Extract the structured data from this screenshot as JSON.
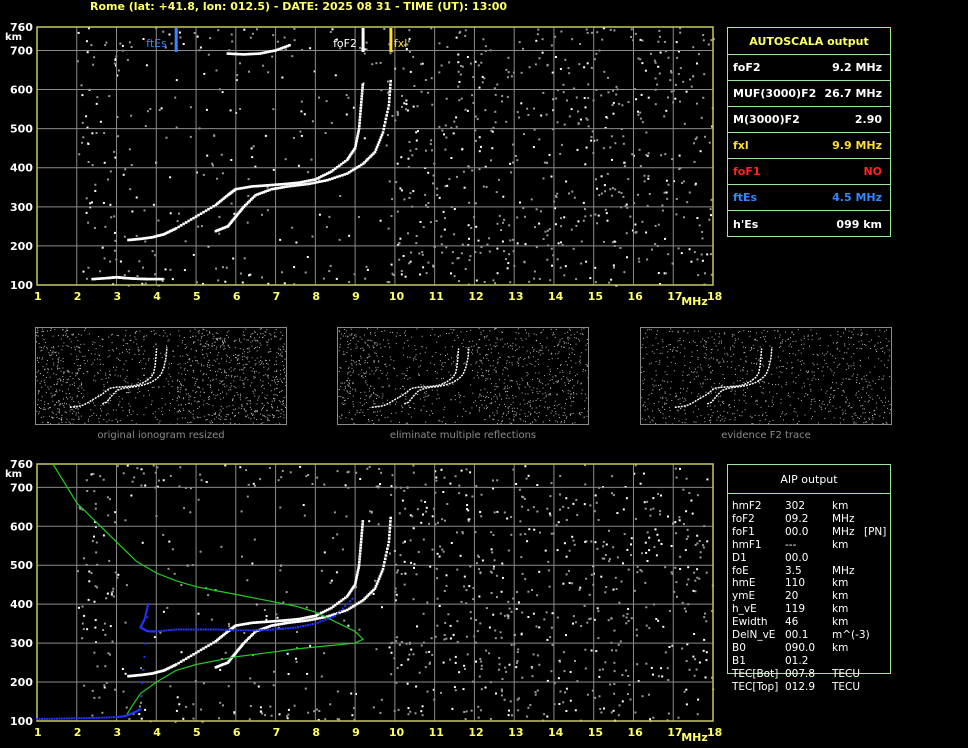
{
  "header": {
    "text": "Rome (lat: +41.8, lon: 012.5) - DATE: 2025 08 31 - TIME (UT): 13:00"
  },
  "colors": {
    "grid": "#8a8a8a",
    "frame": "#c8c860",
    "axis_text": "#ffff66",
    "panel_border": "#9be89b",
    "fxes": "#3388ff",
    "fxl": "#ffdd33",
    "fof2": "#ffffff",
    "no": "#ff2222",
    "profile": "#22cc22",
    "blue_trace": "#2233ff"
  },
  "chart_data": [
    {
      "type": "scatter",
      "title": "",
      "xlabel": "MHz",
      "ylabel": "km",
      "xlim": [
        1,
        18
      ],
      "ylim": [
        100,
        760
      ],
      "xticks": [
        1,
        2,
        3,
        4,
        5,
        6,
        7,
        8,
        9,
        10,
        11,
        12,
        13,
        14,
        15,
        16,
        17,
        18
      ],
      "yticks": [
        100,
        200,
        300,
        400,
        500,
        600,
        700,
        760
      ],
      "grid": true,
      "markers": [
        {
          "name": "ftEs",
          "x": 4.5,
          "color": "#3388ff"
        },
        {
          "name": "foF2",
          "x": 9.2,
          "color": "#ffffff"
        },
        {
          "name": "fxl",
          "x": 9.9,
          "color": "#ffdd33"
        }
      ],
      "series": [
        {
          "x": [
            2.4,
            2.8,
            3.0,
            3.2,
            3.5,
            3.8,
            4.2
          ],
          "y": [
            115,
            118,
            120,
            118,
            116,
            115,
            115
          ]
        },
        {
          "x": [
            3.3,
            3.6,
            3.9,
            4.2,
            4.5,
            5.0,
            5.5,
            5.8,
            6.0,
            6.4,
            6.8,
            7.2,
            7.6,
            8.0,
            8.4,
            8.8,
            9.0,
            9.1,
            9.15,
            9.2
          ],
          "y": [
            215,
            218,
            222,
            230,
            245,
            275,
            305,
            330,
            345,
            352,
            355,
            358,
            362,
            370,
            390,
            420,
            450,
            500,
            560,
            620
          ]
        },
        {
          "x": [
            5.5,
            5.8,
            6.0,
            6.2,
            6.5,
            6.9,
            7.3,
            7.8,
            8.3,
            8.8,
            9.2,
            9.5,
            9.7,
            9.85,
            9.9
          ],
          "y": [
            238,
            250,
            275,
            300,
            330,
            345,
            352,
            358,
            368,
            385,
            410,
            440,
            490,
            560,
            630
          ]
        },
        {
          "x": [
            5.8,
            6.2,
            6.6,
            7.0,
            7.4
          ],
          "y": [
            692,
            690,
            692,
            700,
            715
          ]
        }
      ]
    },
    {
      "type": "scatter",
      "title": "",
      "xlabel": "MHz",
      "ylabel": "km",
      "xlim": [
        1,
        18
      ],
      "ylim": [
        100,
        760
      ],
      "xticks": [
        1,
        2,
        3,
        4,
        5,
        6,
        7,
        8,
        9,
        10,
        11,
        12,
        13,
        14,
        15,
        16,
        17,
        18
      ],
      "yticks": [
        100,
        200,
        300,
        400,
        500,
        600,
        700,
        760
      ],
      "grid": true,
      "series": [
        {
          "x": [
            1.4,
            2.0,
            2.5,
            3.0,
            3.5,
            4.0,
            4.5,
            5.0,
            5.5,
            6.0,
            6.5,
            7.0,
            7.5,
            8.0,
            8.5,
            8.8,
            9.0,
            9.2,
            9.0,
            8.5,
            8.0,
            7.5,
            7.0,
            6.0,
            5.0,
            4.5,
            4.0,
            3.6,
            3.4,
            3.25
          ],
          "y": [
            760,
            660,
            610,
            560,
            510,
            480,
            460,
            445,
            435,
            425,
            415,
            405,
            395,
            380,
            355,
            340,
            330,
            310,
            300,
            295,
            290,
            285,
            278,
            265,
            245,
            230,
            200,
            170,
            140,
            115
          ]
        },
        {
          "x": [
            1.0,
            1.5,
            2.0,
            2.5,
            3.0,
            3.2,
            3.4,
            3.6,
            3.8,
            3.7,
            3.6,
            3.8,
            4.0,
            4.5,
            5.0,
            5.5,
            6.0,
            6.5,
            7.0,
            7.5,
            8.0,
            8.5,
            9.0
          ],
          "y": [
            105,
            106,
            107,
            108,
            110,
            112,
            120,
            130,
            400,
            360,
            340,
            330,
            330,
            335,
            335,
            335,
            333,
            333,
            335,
            340,
            350,
            370,
            420
          ]
        },
        {
          "x": [
            3.3,
            3.6,
            3.9,
            4.2,
            4.5,
            5.0,
            5.5,
            5.8,
            6.0,
            6.4,
            6.8,
            7.2,
            7.6,
            8.0,
            8.4,
            8.8,
            9.0,
            9.1,
            9.15,
            9.2
          ],
          "y": [
            215,
            218,
            222,
            230,
            245,
            275,
            305,
            330,
            345,
            352,
            355,
            358,
            362,
            370,
            390,
            420,
            450,
            500,
            560,
            620
          ]
        },
        {
          "x": [
            5.5,
            5.8,
            6.0,
            6.2,
            6.5,
            6.9,
            7.3,
            7.8,
            8.3,
            8.8,
            9.2,
            9.5,
            9.7,
            9.85,
            9.9
          ],
          "y": [
            238,
            250,
            275,
            300,
            330,
            345,
            352,
            358,
            368,
            385,
            410,
            440,
            490,
            560,
            630
          ]
        }
      ]
    }
  ],
  "autoscala": {
    "title": "AUTOSCALA output",
    "rows": [
      {
        "label": "foF2",
        "value": "9.2 MHz",
        "color": "#ffffff"
      },
      {
        "label": "MUF(3000)F2",
        "value": "26.7 MHz",
        "color": "#ffffff"
      },
      {
        "label": "M(3000)F2",
        "value": "2.90",
        "color": "#ffffff"
      },
      {
        "label": "fxl",
        "value": "9.9 MHz",
        "color": "#ffdd33"
      },
      {
        "label": "foF1",
        "value": "NO",
        "color": "#ff2222"
      },
      {
        "label": "ftEs",
        "value": "4.5 MHz",
        "color": "#3388ff"
      },
      {
        "label": "h'Es",
        "value": "099    km",
        "color": "#ffffff"
      }
    ]
  },
  "thumbnails": [
    {
      "caption": "original ionogram resized"
    },
    {
      "caption": "eliminate multiple reflections"
    },
    {
      "caption": "evidence F2 trace"
    }
  ],
  "aip": {
    "title": "AIP output",
    "rows": [
      {
        "name": "hmF2",
        "value": "302",
        "unit": "km",
        "extra": ""
      },
      {
        "name": "foF2",
        "value": "09.2",
        "unit": "MHz",
        "extra": ""
      },
      {
        "name": "foF1",
        "value": "00.0",
        "unit": "MHz",
        "extra": "[PN]"
      },
      {
        "name": "hmF1",
        "value": "---",
        "unit": "km",
        "extra": ""
      },
      {
        "name": "D1",
        "value": "00.0",
        "unit": "",
        "extra": ""
      },
      {
        "name": "foE",
        "value": "3.5",
        "unit": "MHz",
        "extra": ""
      },
      {
        "name": "hmE",
        "value": "110",
        "unit": "km",
        "extra": ""
      },
      {
        "name": "ymE",
        "value": "20",
        "unit": "km",
        "extra": ""
      },
      {
        "name": "h_vE",
        "value": "119",
        "unit": "km",
        "extra": ""
      },
      {
        "name": "Ewidth",
        "value": "46",
        "unit": "km",
        "extra": ""
      },
      {
        "name": "DelN_vE",
        "value": "00.1",
        "unit": "m^(-3)",
        "extra": ""
      },
      {
        "name": "B0",
        "value": "090.0",
        "unit": "km",
        "extra": ""
      },
      {
        "name": "B1",
        "value": "01.2",
        "unit": "",
        "extra": ""
      },
      {
        "name": "TEC[Bot]",
        "value": "007.8",
        "unit": "TECU",
        "extra": ""
      },
      {
        "name": "TEC[Top]",
        "value": "012.9",
        "unit": "TECU",
        "extra": ""
      }
    ]
  }
}
